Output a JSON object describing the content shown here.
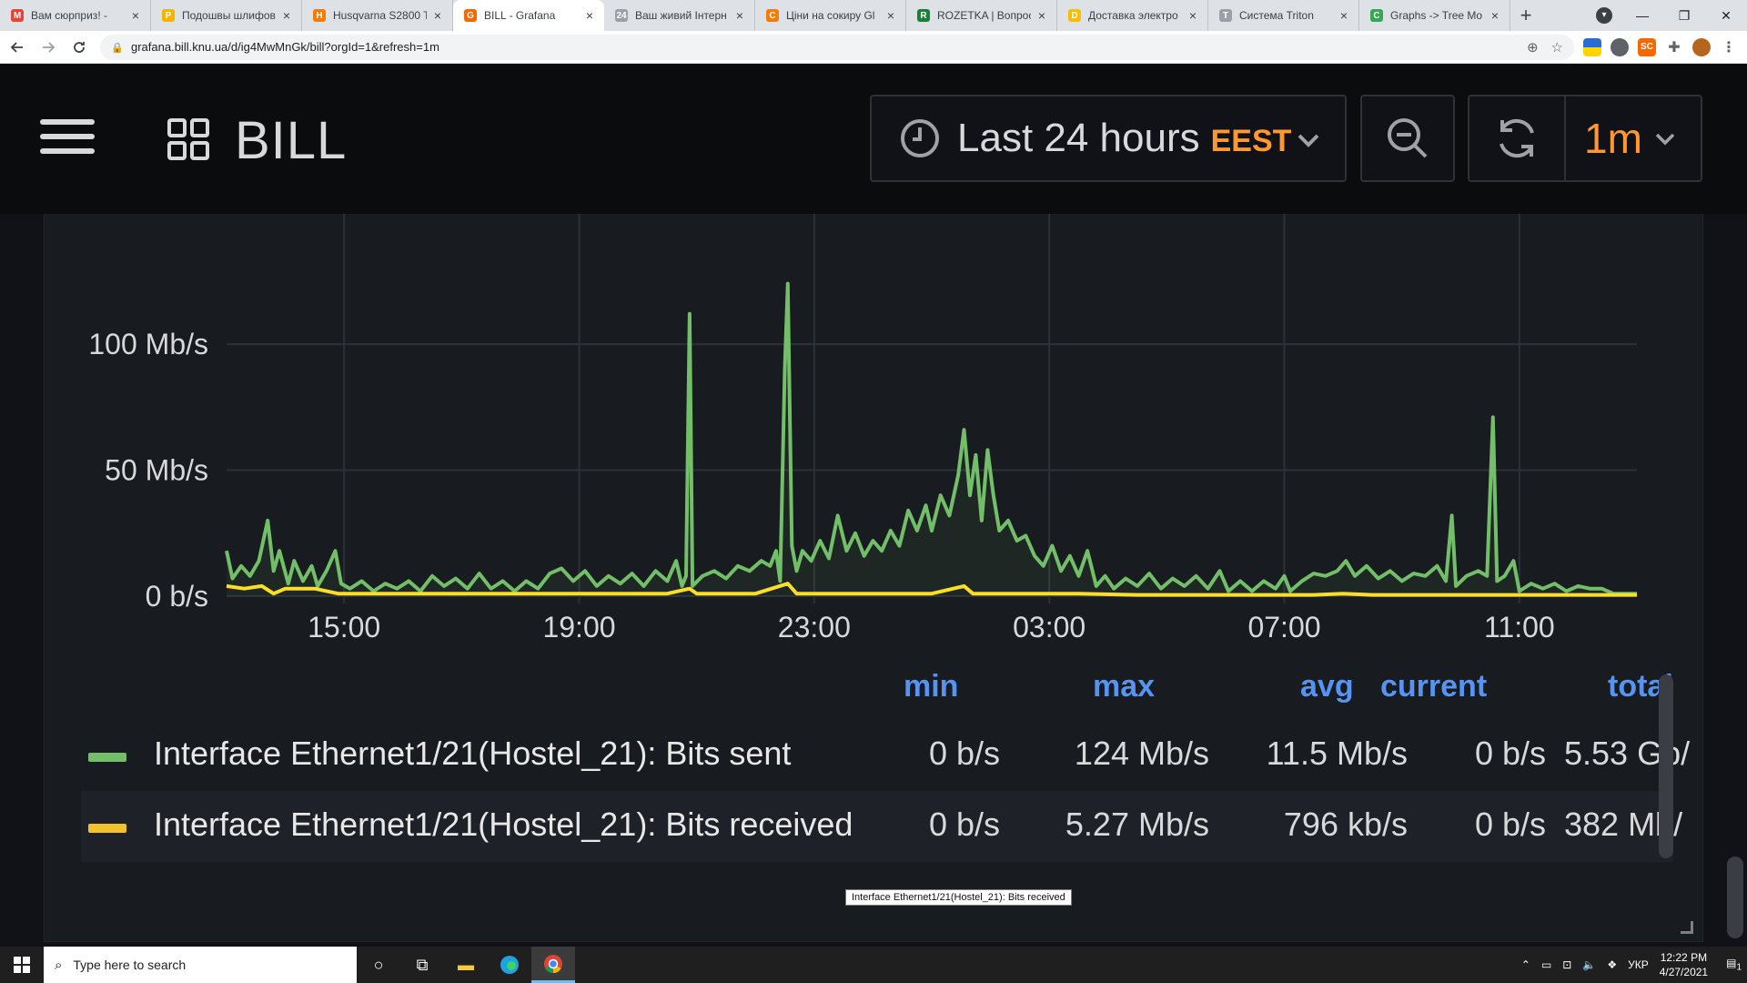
{
  "browser": {
    "tabs": [
      {
        "title": "Вам сюрприз! -",
        "favicon_color": "#ea4335",
        "favicon_text": "M"
      },
      {
        "title": "Подошвы шлифов",
        "favicon_color": "#f4b400",
        "favicon_text": "P"
      },
      {
        "title": "Husqvarna S2800 T",
        "favicon_color": "#f57c00",
        "favicon_text": "H"
      },
      {
        "title": "BILL - Grafana",
        "favicon_color": "#f46800",
        "favicon_text": "G",
        "active": true
      },
      {
        "title": "Ваш живий Інтерн",
        "favicon_color": "#9aa0a6",
        "favicon_text": "24"
      },
      {
        "title": "Ціни на сокиру Gl",
        "favicon_color": "#f57c00",
        "favicon_text": "C"
      },
      {
        "title": "ROZETKA | Вопрос",
        "favicon_color": "#1a7f37",
        "favicon_text": "R"
      },
      {
        "title": "Доставка электро",
        "favicon_color": "#fbbc04",
        "favicon_text": "D"
      },
      {
        "title": "Система Triton",
        "favicon_color": "#9aa0a6",
        "favicon_text": "T"
      },
      {
        "title": "Graphs -> Tree Mo",
        "favicon_color": "#34a853",
        "favicon_text": "C"
      }
    ],
    "new_tab": "+",
    "url": "grafana.bill.knu.ua/d/ig4MwMnGk/bill?orgId=1&refresh=1m",
    "window_controls": [
      "—",
      "❐",
      "✕"
    ]
  },
  "grafana": {
    "dashboard_title": "BILL",
    "time_range": "Last 24 hours",
    "timezone": "EEST",
    "refresh_interval": "1m"
  },
  "chart_data": {
    "type": "line",
    "title": "",
    "xlabel": "",
    "ylabel": "",
    "x_ticks": [
      "15:00",
      "19:00",
      "23:00",
      "03:00",
      "07:00",
      "11:00"
    ],
    "y_ticks": [
      "0 b/s",
      "50 Mb/s",
      "100 Mb/s"
    ],
    "ylim": [
      0,
      130
    ],
    "y_unit": "Mb/s",
    "x_unit": "hours since 13:00",
    "xlim": [
      0,
      24
    ],
    "series": [
      {
        "name": "Interface Ethernet1/21(Hostel_21): Bits sent",
        "color": "#73bf69",
        "points": [
          [
            0.0,
            18
          ],
          [
            0.1,
            7
          ],
          [
            0.25,
            12
          ],
          [
            0.4,
            8
          ],
          [
            0.55,
            14
          ],
          [
            0.7,
            30
          ],
          [
            0.8,
            10
          ],
          [
            0.9,
            18
          ],
          [
            1.05,
            5
          ],
          [
            1.15,
            14
          ],
          [
            1.3,
            6
          ],
          [
            1.45,
            12
          ],
          [
            1.55,
            4
          ],
          [
            1.7,
            10
          ],
          [
            1.85,
            18
          ],
          [
            1.95,
            5
          ],
          [
            2.1,
            3
          ],
          [
            2.3,
            6
          ],
          [
            2.5,
            2
          ],
          [
            2.7,
            5
          ],
          [
            2.9,
            3
          ],
          [
            3.1,
            6
          ],
          [
            3.3,
            2
          ],
          [
            3.5,
            8
          ],
          [
            3.7,
            4
          ],
          [
            3.9,
            7
          ],
          [
            4.1,
            3
          ],
          [
            4.3,
            9
          ],
          [
            4.5,
            3
          ],
          [
            4.7,
            6
          ],
          [
            4.9,
            2
          ],
          [
            5.1,
            6
          ],
          [
            5.3,
            3
          ],
          [
            5.5,
            9
          ],
          [
            5.7,
            11
          ],
          [
            5.9,
            6
          ],
          [
            6.1,
            10
          ],
          [
            6.3,
            4
          ],
          [
            6.5,
            8
          ],
          [
            6.7,
            5
          ],
          [
            6.9,
            9
          ],
          [
            7.1,
            4
          ],
          [
            7.3,
            10
          ],
          [
            7.5,
            6
          ],
          [
            7.65,
            14
          ],
          [
            7.75,
            4
          ],
          [
            7.82,
            8
          ],
          [
            7.88,
            112
          ],
          [
            7.93,
            4
          ],
          [
            8.1,
            8
          ],
          [
            8.3,
            10
          ],
          [
            8.5,
            7
          ],
          [
            8.7,
            12
          ],
          [
            8.9,
            10
          ],
          [
            9.1,
            14
          ],
          [
            9.25,
            12
          ],
          [
            9.35,
            18
          ],
          [
            9.42,
            6
          ],
          [
            9.5,
            90
          ],
          [
            9.55,
            124
          ],
          [
            9.62,
            20
          ],
          [
            9.7,
            10
          ],
          [
            9.8,
            18
          ],
          [
            9.95,
            14
          ],
          [
            10.1,
            22
          ],
          [
            10.25,
            15
          ],
          [
            10.4,
            32
          ],
          [
            10.55,
            18
          ],
          [
            10.7,
            25
          ],
          [
            10.85,
            16
          ],
          [
            11.0,
            22
          ],
          [
            11.15,
            18
          ],
          [
            11.3,
            26
          ],
          [
            11.45,
            20
          ],
          [
            11.6,
            34
          ],
          [
            11.75,
            26
          ],
          [
            11.9,
            36
          ],
          [
            12.0,
            26
          ],
          [
            12.15,
            40
          ],
          [
            12.3,
            32
          ],
          [
            12.45,
            48
          ],
          [
            12.55,
            66
          ],
          [
            12.65,
            40
          ],
          [
            12.75,
            56
          ],
          [
            12.85,
            30
          ],
          [
            12.95,
            58
          ],
          [
            13.05,
            40
          ],
          [
            13.15,
            26
          ],
          [
            13.3,
            30
          ],
          [
            13.45,
            22
          ],
          [
            13.6,
            24
          ],
          [
            13.75,
            16
          ],
          [
            13.9,
            12
          ],
          [
            14.05,
            20
          ],
          [
            14.2,
            10
          ],
          [
            14.35,
            16
          ],
          [
            14.5,
            8
          ],
          [
            14.65,
            18
          ],
          [
            14.8,
            4
          ],
          [
            14.95,
            8
          ],
          [
            15.1,
            3
          ],
          [
            15.3,
            7
          ],
          [
            15.5,
            4
          ],
          [
            15.7,
            9
          ],
          [
            15.9,
            3
          ],
          [
            16.1,
            7
          ],
          [
            16.3,
            4
          ],
          [
            16.5,
            8
          ],
          [
            16.7,
            3
          ],
          [
            16.9,
            10
          ],
          [
            17.05,
            2
          ],
          [
            17.25,
            6
          ],
          [
            17.45,
            2
          ],
          [
            17.65,
            6
          ],
          [
            17.85,
            3
          ],
          [
            18.0,
            8
          ],
          [
            18.1,
            2
          ],
          [
            18.3,
            6
          ],
          [
            18.5,
            9
          ],
          [
            18.7,
            8
          ],
          [
            18.9,
            10
          ],
          [
            19.05,
            14
          ],
          [
            19.2,
            8
          ],
          [
            19.4,
            12
          ],
          [
            19.6,
            7
          ],
          [
            19.8,
            10
          ],
          [
            20.0,
            6
          ],
          [
            20.2,
            9
          ],
          [
            20.4,
            8
          ],
          [
            20.6,
            12
          ],
          [
            20.75,
            6
          ],
          [
            20.85,
            32
          ],
          [
            20.92,
            4
          ],
          [
            21.1,
            8
          ],
          [
            21.3,
            10
          ],
          [
            21.45,
            8
          ],
          [
            21.55,
            71
          ],
          [
            21.62,
            6
          ],
          [
            21.75,
            8
          ],
          [
            21.9,
            14
          ],
          [
            22.0,
            2
          ],
          [
            22.2,
            5
          ],
          [
            22.4,
            3
          ],
          [
            22.6,
            5
          ],
          [
            22.8,
            2
          ],
          [
            23.0,
            4
          ],
          [
            23.2,
            3
          ],
          [
            23.4,
            3
          ],
          [
            23.6,
            1
          ],
          [
            24.0,
            1
          ]
        ]
      },
      {
        "name": "Interface Ethernet1/21(Hostel_21): Bits received",
        "color": "#fade2a",
        "points": [
          [
            0.0,
            4
          ],
          [
            0.3,
            3
          ],
          [
            0.6,
            4
          ],
          [
            0.8,
            1
          ],
          [
            1.0,
            3
          ],
          [
            1.5,
            3
          ],
          [
            1.9,
            1
          ],
          [
            2.5,
            1
          ],
          [
            3.0,
            1
          ],
          [
            3.5,
            1
          ],
          [
            4.0,
            1
          ],
          [
            4.5,
            1
          ],
          [
            5.0,
            1
          ],
          [
            5.5,
            1
          ],
          [
            6.0,
            1
          ],
          [
            6.5,
            1
          ],
          [
            7.0,
            1
          ],
          [
            7.5,
            1
          ],
          [
            7.88,
            3
          ],
          [
            8.0,
            1
          ],
          [
            8.5,
            1
          ],
          [
            9.0,
            1
          ],
          [
            9.55,
            5
          ],
          [
            9.7,
            1
          ],
          [
            10.5,
            1
          ],
          [
            11.0,
            1
          ],
          [
            11.5,
            1
          ],
          [
            12.0,
            1
          ],
          [
            12.55,
            4
          ],
          [
            12.7,
            1
          ],
          [
            13.5,
            1
          ],
          [
            14.5,
            1
          ],
          [
            15.5,
            0.5
          ],
          [
            16.5,
            0.5
          ],
          [
            17.5,
            0.5
          ],
          [
            18.5,
            0.5
          ],
          [
            19.0,
            1
          ],
          [
            19.5,
            0.5
          ],
          [
            20.5,
            0.5
          ],
          [
            21.5,
            0.5
          ],
          [
            22.5,
            0.5
          ],
          [
            23.5,
            0.5
          ],
          [
            24.0,
            0.5
          ]
        ]
      }
    ],
    "grid": true,
    "legend": "bottom"
  },
  "legend": {
    "headers": {
      "min": "min",
      "max": "max",
      "avg": "avg",
      "current": "current",
      "total": "total"
    },
    "rows": [
      {
        "name": "Interface Ethernet1/21(Hostel_21): Bits sent",
        "color": "#73bf69",
        "min": "0 b/s",
        "max": "124 Mb/s",
        "avg": "11.5 Mb/s",
        "current": "0 b/s",
        "total": "5.53 Gb/"
      },
      {
        "name": "Interface Ethernet1/21(Hostel_21): Bits received",
        "color": "#f2c12e",
        "min": "0 b/s",
        "max": "5.27 Mb/s",
        "avg": "796 kb/s",
        "current": "0 b/s",
        "total": "382 Mb/"
      }
    ],
    "tooltip": "Interface Ethernet1/21(Hostel_21): Bits received"
  },
  "taskbar": {
    "search_placeholder": "Type here to search",
    "language": "УКР",
    "time": "12:22 PM",
    "date": "4/27/2021",
    "notification_count": "1"
  }
}
